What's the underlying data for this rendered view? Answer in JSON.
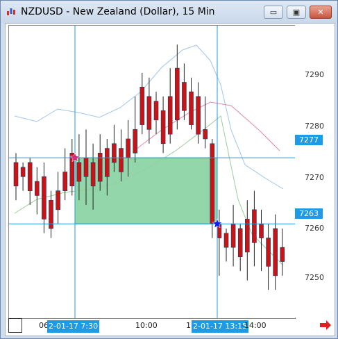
{
  "window": {
    "title": "NZDUSD - New Zealand (Dollar), 15 Min",
    "minimize_glyph": "▭",
    "maximize_glyph": "▣",
    "close_glyph": "✕"
  },
  "chart_data": {
    "type": "candlestick",
    "y_ticks": [
      "7290",
      "7280",
      "7270",
      "7260",
      "7250"
    ],
    "ylim": [
      7243,
      7305
    ],
    "crosshair_price_labels": [
      "7277",
      "7263"
    ],
    "x_labels": [
      "06:",
      "10:00",
      "1",
      "-14:00"
    ],
    "x_highlight_labels": [
      "2-01-17  7:30",
      "2-01-17 13:15"
    ],
    "rectangle": {
      "price_top": 7277,
      "price_bottom": 7263
    },
    "markers": [
      {
        "name": "start-marker",
        "price": 7277,
        "color": "#e0207a"
      },
      {
        "name": "end-marker",
        "price": 7263,
        "color": "#1020e0"
      }
    ]
  },
  "colors": {
    "bull": "#1e74d0",
    "bear": "#c81414",
    "crosshair": "#1e9be6",
    "rect_fill": "#7fcf9a"
  }
}
